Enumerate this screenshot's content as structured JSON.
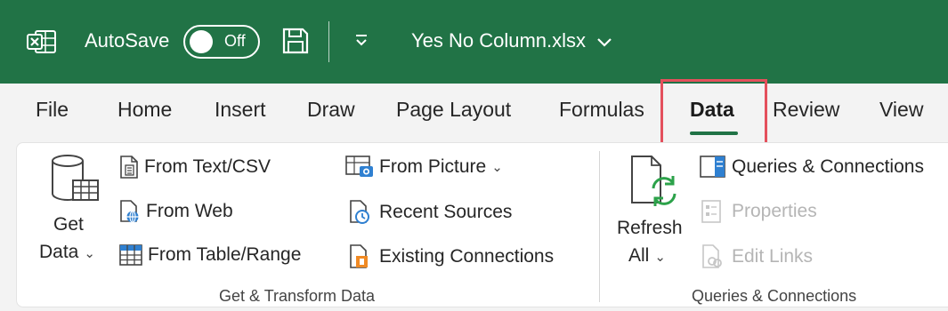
{
  "titlebar": {
    "app_icon": "excel-icon",
    "autosave_label": "AutoSave",
    "autosave_state": "Off",
    "save_icon": "save-icon",
    "quick_access_icon": "customize-quick-access-icon",
    "filename": "Yes No Column.xlsx",
    "filename_icon": "chevron-down-icon"
  },
  "tabs": [
    {
      "label": "File"
    },
    {
      "label": "Home"
    },
    {
      "label": "Insert"
    },
    {
      "label": "Draw"
    },
    {
      "label": "Page Layout"
    },
    {
      "label": "Formulas"
    },
    {
      "label": "Data",
      "active": true
    },
    {
      "label": "Review"
    },
    {
      "label": "View"
    }
  ],
  "ribbon": {
    "get_transform": {
      "get_data": {
        "line1": "Get",
        "line2": "Data",
        "icon": "database-icon"
      },
      "from_text_csv": {
        "label": "From Text/CSV",
        "icon": "text-file-icon"
      },
      "from_web": {
        "label": "From Web",
        "icon": "web-page-icon"
      },
      "from_table_range": {
        "label": "From Table/Range",
        "icon": "table-icon"
      },
      "from_picture": {
        "label": "From Picture",
        "icon": "picture-icon"
      },
      "recent_sources": {
        "label": "Recent Sources",
        "icon": "recent-sources-icon"
      },
      "existing_connections": {
        "label": "Existing Connections",
        "icon": "existing-connections-icon"
      },
      "group_label": "Get & Transform Data"
    },
    "queries_connections": {
      "refresh_all": {
        "line1": "Refresh",
        "line2": "All",
        "icon": "refresh-icon"
      },
      "queries_connections": {
        "label": "Queries & Connections",
        "icon": "queries-pane-icon"
      },
      "properties": {
        "label": "Properties",
        "icon": "properties-icon",
        "disabled": true
      },
      "edit_links": {
        "label": "Edit Links",
        "icon": "edit-links-icon",
        "disabled": true
      },
      "group_label": "Queries & Connections"
    }
  },
  "colors": {
    "titlebar_bg": "#217346",
    "highlight_border": "#e4505c",
    "active_underline": "#217346"
  }
}
